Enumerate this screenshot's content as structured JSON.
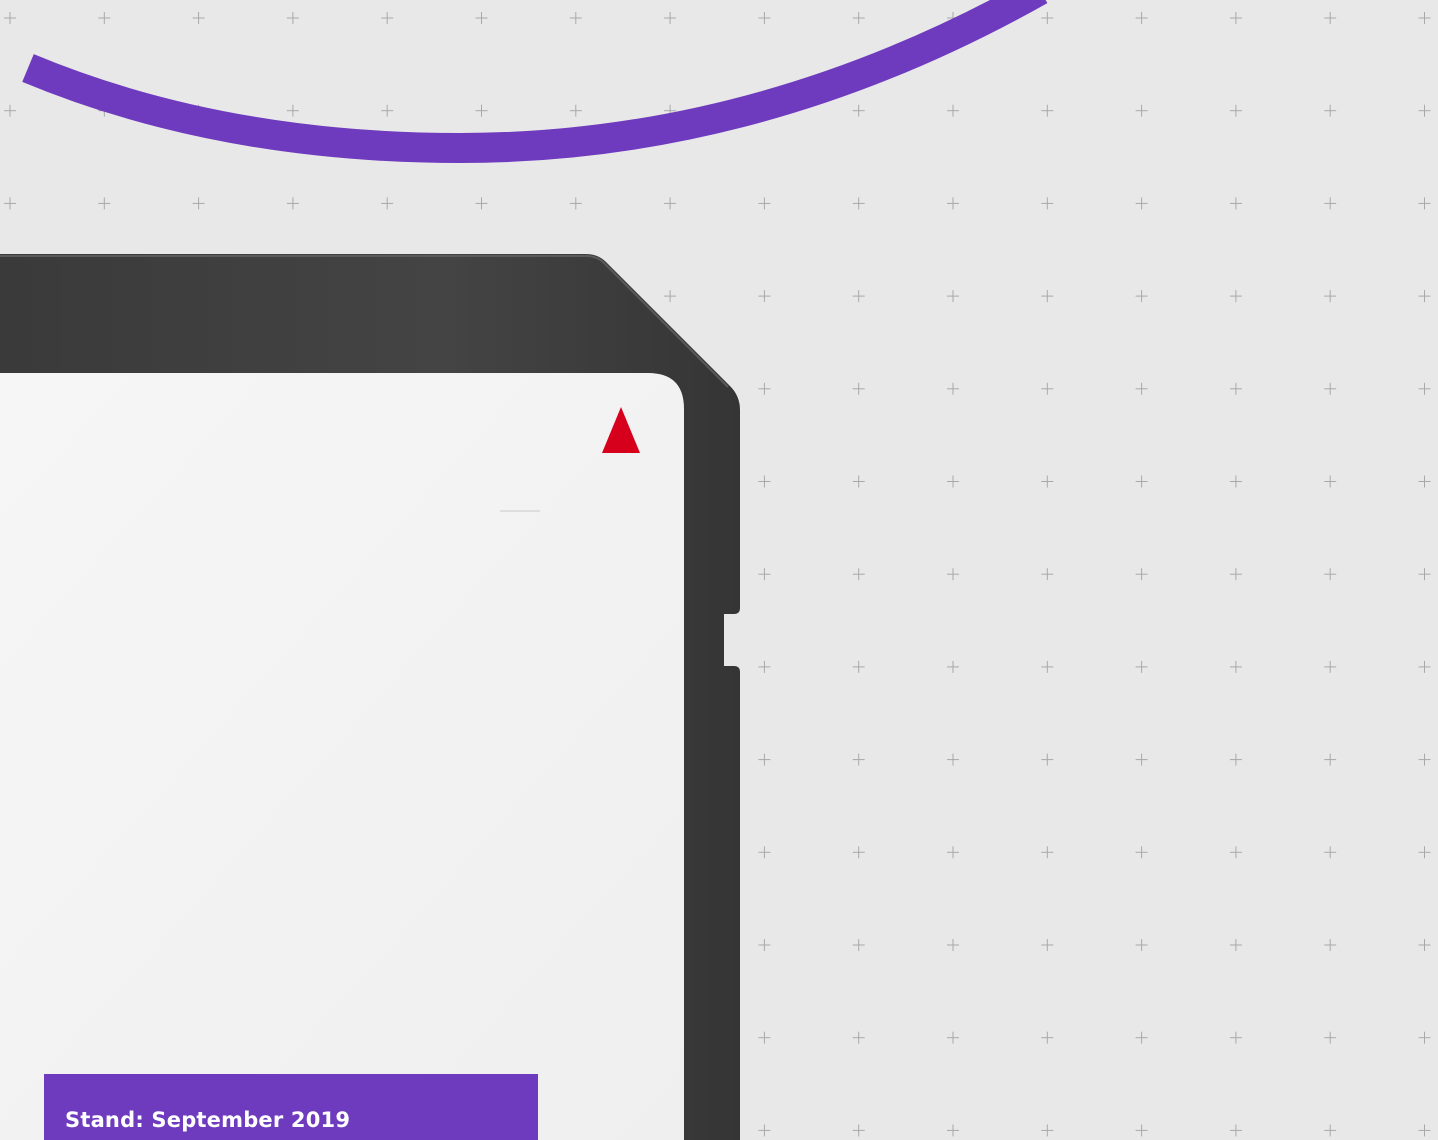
{
  "cover": {
    "date_label": "Stand: September 2019"
  },
  "colors": {
    "background": "#e8e8e8",
    "grid_plus": "#a8a8a8",
    "accent_purple": "#6e3bbf",
    "card_frame": "#3b3b3b",
    "card_label": "#f4f4f4",
    "marker_red": "#d6001c",
    "date_text": "#ffffff"
  },
  "icons": {
    "orientation_marker": "red-triangle-icon"
  }
}
